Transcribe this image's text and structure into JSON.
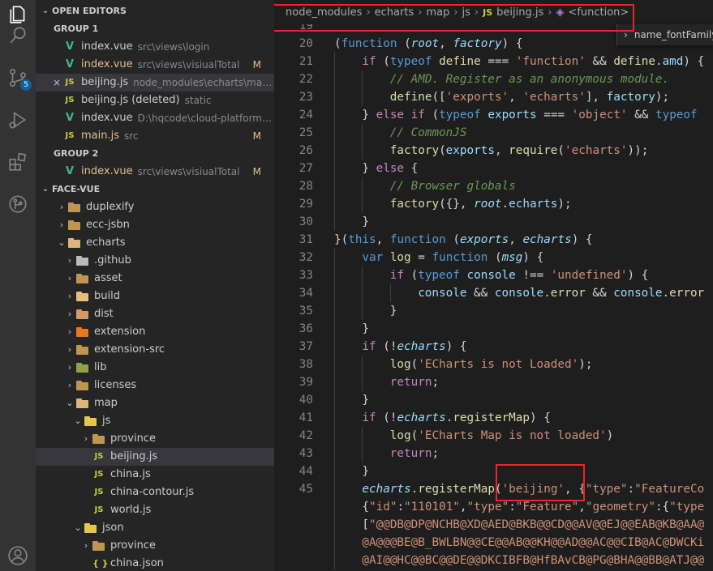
{
  "activity": {
    "icons": [
      "explorer-icon",
      "search-icon",
      "source-control-icon",
      "run-debug-icon",
      "extensions-icon",
      "remote-icon",
      "account-icon"
    ],
    "scm_badge": "5"
  },
  "open_editors": {
    "title": "OPEN EDITORS",
    "group1": "GROUP 1",
    "group2": "GROUP 2",
    "items": [
      {
        "icon": "V",
        "name": "index.vue",
        "path": "src\\views\\login",
        "status": ""
      },
      {
        "icon": "V",
        "name": "index.vue",
        "path": "src\\views\\visiualTotal",
        "status": "M"
      },
      {
        "icon": "JS",
        "name": "beijing.js",
        "path": "node_modules\\echarts\\map\\js",
        "status": "",
        "close": "×"
      },
      {
        "icon": "JS",
        "name": "beijing.js (deleted)",
        "path": "static",
        "status": ""
      },
      {
        "icon": "V",
        "name": "index.vue",
        "path": "D:\\hqcode\\cloud-platform-ui\\cl...",
        "status": ""
      },
      {
        "icon": "JS",
        "name": "main.js",
        "path": "src",
        "status": "M"
      },
      {
        "icon": "V",
        "name": "index.vue",
        "path": "src\\views\\visiualTotal",
        "status": "M"
      }
    ]
  },
  "explorer": {
    "title": "FACE-VUE",
    "tree": [
      {
        "name": "duplexify",
        "expanded": false
      },
      {
        "name": "ecc-jsbn",
        "expanded": false
      },
      {
        "name": "echarts",
        "expanded": true
      },
      {
        "name": ".github",
        "expanded": false
      },
      {
        "name": "asset",
        "expanded": false
      },
      {
        "name": "build",
        "expanded": false
      },
      {
        "name": "dist",
        "expanded": false
      },
      {
        "name": "extension",
        "expanded": false
      },
      {
        "name": "extension-src",
        "expanded": false
      },
      {
        "name": "lib",
        "expanded": false
      },
      {
        "name": "licenses",
        "expanded": false
      },
      {
        "name": "map",
        "expanded": true
      },
      {
        "name": "js",
        "expanded": true
      },
      {
        "name": "province",
        "expanded": false
      },
      {
        "name": "beijing.js",
        "file": "JS"
      },
      {
        "name": "china.js",
        "file": "JS"
      },
      {
        "name": "china-contour.js",
        "file": "JS"
      },
      {
        "name": "world.js",
        "file": "JS"
      },
      {
        "name": "json",
        "expanded": true
      },
      {
        "name": "province",
        "expanded": false
      },
      {
        "name": "china.json",
        "file": "{ }"
      }
    ]
  },
  "breadcrumb": {
    "parts": [
      "node_modules",
      "echarts",
      "map",
      "js"
    ],
    "js_tag": "JS",
    "file": "beijing.js",
    "symbol_icon": "◈",
    "symbol": "<function>",
    "dropdown_chevron": "›",
    "dropdown_item": "name_fontFamily"
  },
  "code": {
    "line_numbers": [
      "19",
      "20",
      "21",
      "22",
      "23",
      "24",
      "25",
      "26",
      "27",
      "28",
      "29",
      "30",
      "31",
      "32",
      "33",
      "34",
      "35",
      "36",
      "37",
      "38",
      "39",
      "40",
      "41",
      "42",
      "43",
      "44",
      "45",
      "",
      "",
      "",
      ""
    ],
    "l20": [
      "(",
      "function",
      " (",
      "root",
      ", ",
      "factory",
      ") {"
    ],
    "l21": [
      "if",
      " (",
      "typeof",
      " ",
      "define",
      " === ",
      "'function'",
      " && ",
      "define",
      ".",
      "amd",
      ") {"
    ],
    "l22": "// AMD. Register as an anonymous module.",
    "l23": [
      "define",
      "([",
      "'exports'",
      ", ",
      "'echarts'",
      "], ",
      "factory",
      ");"
    ],
    "l24": [
      "} ",
      "else",
      " ",
      "if",
      " (",
      "typeof",
      " ",
      "exports",
      " === ",
      "'object'",
      " && ",
      "typeof"
    ],
    "l25": "// CommonJS",
    "l26": [
      "factory",
      "(",
      "exports",
      ", ",
      "require",
      "(",
      "'echarts'",
      "));"
    ],
    "l27": [
      "} ",
      "else",
      " {"
    ],
    "l28": "// Browser globals",
    "l29": [
      "factory",
      "({}, ",
      "root",
      ".",
      "echarts",
      ");"
    ],
    "l30": "}",
    "l31": [
      "}(",
      "this",
      ", ",
      "function",
      " (",
      "exports",
      ", ",
      "echarts",
      ") {"
    ],
    "l32": [
      "var",
      " ",
      "log",
      " = ",
      "function",
      " (",
      "msg",
      ") {"
    ],
    "l33": [
      "if",
      " (",
      "typeof",
      " ",
      "console",
      " !== ",
      "'undefined'",
      ") {"
    ],
    "l34": [
      "console",
      " && ",
      "console",
      ".",
      "error",
      " && ",
      "console",
      ".",
      "error"
    ],
    "l35": "}",
    "l36": "}",
    "l37": [
      "if",
      " (!",
      "echarts",
      ") {"
    ],
    "l38": [
      "log",
      "(",
      "'ECharts is not Loaded'",
      ");"
    ],
    "l39": [
      "return",
      ";"
    ],
    "l40": "}",
    "l41": [
      "if",
      " (!",
      "echarts",
      ".",
      "registerMap",
      ") {"
    ],
    "l42": [
      "log",
      "(",
      "'ECharts Map is not loaded'",
      ")"
    ],
    "l43": [
      "return",
      ";"
    ],
    "l44": "}",
    "l45": [
      "echarts",
      ".",
      "registerMap",
      "(",
      "'beijing'",
      ", {",
      "\"type\"",
      ":",
      "\"FeatureCo"
    ],
    "l46": [
      "{",
      "\"id\"",
      ":",
      "\"110101\"",
      ",",
      "\"type\"",
      ":",
      "\"Feature\"",
      ",",
      "\"geometry\"",
      ":{",
      "\"type"
    ],
    "l47": [
      "[",
      "\"@@DB@DP@NCHB@XD@AED@BKB@@CD@@AV@@EJ@@EAB@KB@AA@"
    ],
    "l48": "@A@@@BE@B_BWLBN@@CE@@AB@@KH@@AD@@AC@@CIB@AC@DWCKi",
    "l49": "@AI@@HC@@BC@@DE@@DKCIBFB@HfBAvCB@PG@BHA@@BB@ATJ@@"
  }
}
